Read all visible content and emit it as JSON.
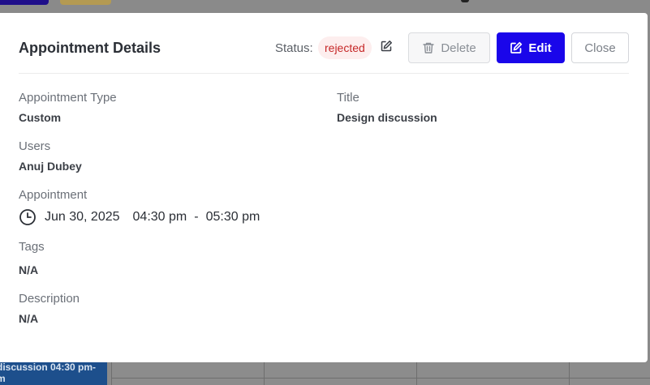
{
  "modal": {
    "title": "Appointment Details",
    "status_label": "Status:",
    "status_value": "rejected",
    "buttons": {
      "delete": "Delete",
      "edit": "Edit",
      "close": "Close"
    }
  },
  "details": {
    "type_label": "Appointment Type",
    "type_value": "Custom",
    "title_label": "Title",
    "title_value": "Design discussion",
    "users_label": "Users",
    "users_value": "Anuj Dubey",
    "appointment_label": "Appointment",
    "date": "Jun 30, 2025",
    "start_time": "04:30 pm",
    "separator": "-",
    "end_time": "05:30 pm",
    "tags_label": "Tags",
    "tags_value": "N/A",
    "description_label": "Description",
    "description_value": "N/A"
  },
  "background": {
    "event_line1": "discussion 04:30 pm-",
    "event_line2": "m"
  },
  "colors": {
    "primary": "#1a06ea",
    "status_bg": "#fdeeee",
    "status_text": "#c62828"
  },
  "icons": {
    "delete": "trash-icon",
    "edit": "pencil-square-icon",
    "status_edit": "edit-icon",
    "time": "clock-icon"
  }
}
